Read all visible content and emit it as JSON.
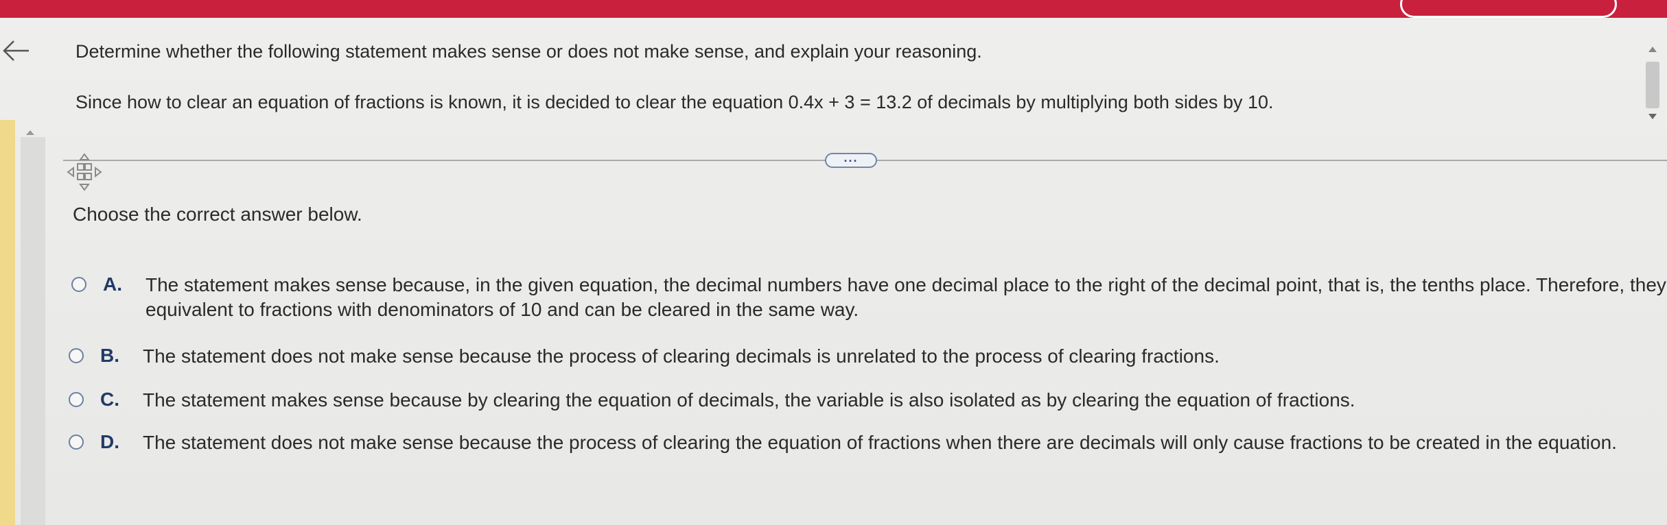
{
  "question": {
    "instruction": "Determine whether the following statement makes sense or does not make sense, and explain your reasoning.",
    "statement": "Since how to clear an equation of fractions is known, it is decided to clear the equation 0.4x + 3 = 13.2 of decimals by multiplying both sides by 10."
  },
  "more_label": "...",
  "prompt": "Choose the correct answer below.",
  "options": [
    {
      "letter": "A.",
      "text": "The statement makes sense because, in the given equation, the decimal numbers have one decimal place to the right of the decimal point, that is, the tenths place. Therefore, they are equivalent to fractions with denominators of 10 and can be cleared in the same way."
    },
    {
      "letter": "B.",
      "text": "The statement does not make sense because the process of clearing decimals is unrelated to the process of clearing fractions."
    },
    {
      "letter": "C.",
      "text": "The statement makes sense because by clearing the equation of decimals, the variable is also isolated as by clearing the equation of fractions."
    },
    {
      "letter": "D.",
      "text": "The statement does not make sense because the process of clearing the equation of fractions when there are decimals will only cause fractions to be created in the equation."
    }
  ],
  "icons": {
    "back": "back-arrow-icon",
    "move": "move-arrows-icon",
    "scroll_up": "chevron-up-icon",
    "scroll_down": "chevron-down-icon"
  },
  "colors": {
    "topbar": "#c8203d",
    "option_letter": "#223a66",
    "radio_border": "#6d7fa0"
  }
}
